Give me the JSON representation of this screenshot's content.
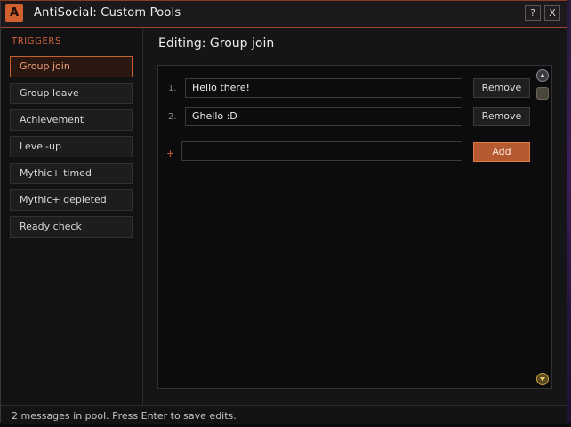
{
  "window": {
    "title": "AntiSocial: Custom Pools",
    "logo_letter": "A",
    "help_label": "?",
    "close_label": "X"
  },
  "sidebar": {
    "heading": "TRIGGERS",
    "items": [
      {
        "label": "Group join",
        "active": true
      },
      {
        "label": "Group leave"
      },
      {
        "label": "Achievement"
      },
      {
        "label": "Level-up"
      },
      {
        "label": "Mythic+ timed"
      },
      {
        "label": "Mythic+ depleted"
      },
      {
        "label": "Ready check"
      }
    ]
  },
  "main": {
    "title": "Editing: Group join",
    "messages": [
      {
        "index": "1.",
        "value": "Hello there!",
        "remove_label": "Remove"
      },
      {
        "index": "2.",
        "value": "Ghello :D",
        "remove_label": "Remove"
      }
    ],
    "new_marker": "+",
    "new_value": "",
    "add_label": "Add"
  },
  "status": {
    "text": "2 messages in pool. Press Enter to save edits."
  },
  "colors": {
    "accent": "#d0612e",
    "add_button": "#b55a30",
    "active_item_border": "#c6612f"
  }
}
